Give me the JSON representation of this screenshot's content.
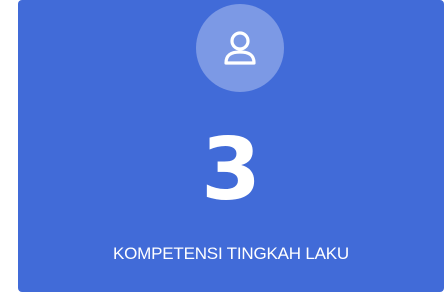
{
  "card": {
    "icon": "user-icon",
    "count": "3",
    "label": "KOMPETENSI TINGKAH LAKU",
    "background_color": "#416bd8",
    "icon_circle_color": "#7c99e5",
    "text_color": "#ffffff"
  }
}
